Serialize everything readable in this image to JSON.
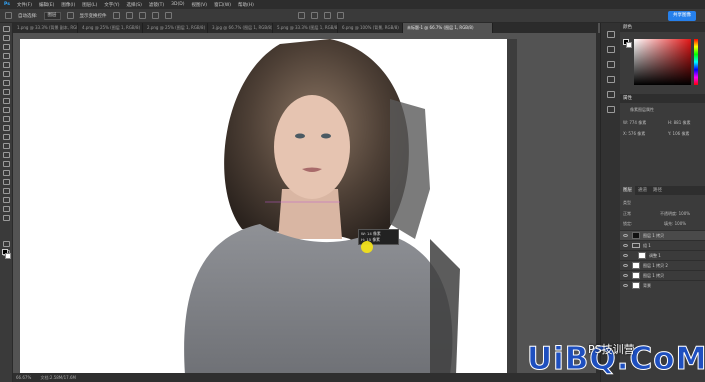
{
  "menubar": {
    "items": [
      "文件(F)",
      "编辑(E)",
      "图像(I)",
      "图层(L)",
      "文字(Y)",
      "选择(S)",
      "滤镜(T)",
      "3D(D)",
      "视图(V)",
      "窗口(W)",
      "帮助(H)"
    ]
  },
  "optionsbar": {
    "auto_select_label": "自动选择:",
    "auto_select_value": "图层",
    "transform_label": "显示变换控件",
    "share_label": "共享图像"
  },
  "tabs": [
    {
      "label": "1.png @ 33.3% (背景 副本, RGB/8)"
    },
    {
      "label": "4.png @ 25% (图层 1, RGB/8)"
    },
    {
      "label": "2.png @ 25% (图层 1, RGB/8)"
    },
    {
      "label": "3.jpg @ 66.7% (图层 1, RGB/8)"
    },
    {
      "label": "5.png @ 33.3% (图层 1, RGB/8)"
    },
    {
      "label": "6.png @ 100% (背景, RGB/8)"
    },
    {
      "label": "未标题-1 @ 66.7% (图层 1, RGB/8)"
    }
  ],
  "panels": {
    "color_tab": "颜色",
    "properties_tab": "属性",
    "properties_title": "像素图层属性",
    "w_label": "W: 774 像素",
    "h_label": "H: 881 像素",
    "x_label": "X: 576 像素",
    "y_label": "Y: 106 像素",
    "layers_tab": "图层",
    "channels_tab": "通道",
    "paths_tab": "路径",
    "kind_label": "类型",
    "blend_mode": "正常",
    "opacity_label": "不透明度: 100%",
    "fill_label": "填充: 100%",
    "lock_label": "锁定:"
  },
  "layers": [
    {
      "name": "图层 1 拷贝",
      "thumb": "dark",
      "selected": true
    },
    {
      "name": "组 1",
      "thumb": "group",
      "selected": false
    },
    {
      "name": "调整 1",
      "thumb": "light",
      "selected": false
    },
    {
      "name": "图层 1 拷贝 2",
      "thumb": "light",
      "selected": false
    },
    {
      "name": "图层 1 拷贝",
      "thumb": "light",
      "selected": false
    },
    {
      "name": "背景",
      "thumb": "light",
      "selected": false
    }
  ],
  "statusbar": {
    "zoom": "66.67%",
    "doc": "文档:2.58M/17.6M"
  },
  "tooltip": {
    "line1": "W: 14 像素",
    "line2": "H: 15 像素"
  },
  "watermark": {
    "brand": "UiBQ.CoM",
    "cn": "PS技训营"
  },
  "colors": {
    "ps_blue": "#2680eb",
    "watermark_blue": "#1e4fbf",
    "cursor_yellow": "#f2e11a"
  }
}
